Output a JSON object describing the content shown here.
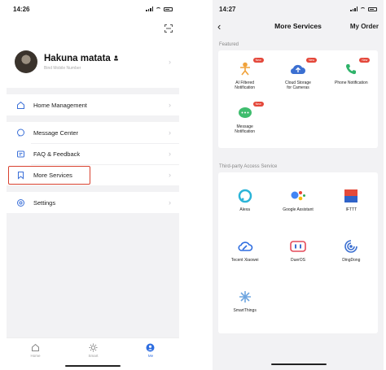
{
  "left": {
    "status_time": "14:26",
    "profile": {
      "name": "Hakuna matata",
      "subtitle": "Bind Mobile Number"
    },
    "menu_group_1": [
      {
        "label": "Home Management",
        "icon": "house-icon"
      }
    ],
    "menu_group_2": [
      {
        "label": "Message Center",
        "icon": "chat-icon"
      },
      {
        "label": "FAQ & Feedback",
        "icon": "feedback-icon"
      },
      {
        "label": "More Services",
        "icon": "bookmark-icon",
        "highlighted": true
      }
    ],
    "menu_group_3": [
      {
        "label": "Settings",
        "icon": "gear-icon"
      }
    ],
    "tabs": [
      {
        "label": "Home",
        "icon": "house-icon",
        "active": false
      },
      {
        "label": "Smart",
        "icon": "sun-icon",
        "active": false
      },
      {
        "label": "Me",
        "icon": "person-icon",
        "active": true
      }
    ],
    "highlight_color": "#d8412f"
  },
  "right": {
    "status_time": "14:27",
    "nav": {
      "title": "More Services",
      "action": "My Order"
    },
    "featured_title": "Featured",
    "featured": [
      {
        "label": "AI Filtered\nNotification",
        "icon": "ai-person-icon",
        "badge": "New"
      },
      {
        "label": "Cloud Storage\nfor Cameras",
        "icon": "cloud-upload-icon",
        "badge": "New"
      },
      {
        "label": "Phone Notification",
        "icon": "phone-icon",
        "badge": "New"
      },
      {
        "label": "Message\nNotification",
        "icon": "message-bubble-icon",
        "badge": "New"
      }
    ],
    "third_party_title": "Third-party Access Service",
    "third_party": [
      {
        "label": "Alexa",
        "icon": "alexa-icon"
      },
      {
        "label": "Google Assistant",
        "icon": "google-assistant-icon"
      },
      {
        "label": "IFTTT",
        "icon": "ifttt-icon"
      },
      {
        "label": "Tecent Xiaowei",
        "icon": "xiaowei-icon"
      },
      {
        "label": "DuerOS",
        "icon": "dueros-icon"
      },
      {
        "label": "DingDong",
        "icon": "dingdong-icon"
      },
      {
        "label": "SmartThings",
        "icon": "smartthings-icon"
      }
    ],
    "accent_colors": {
      "alexa": "#2bb4d8",
      "google_blue": "#4285f4",
      "google_red": "#ea4335",
      "google_yellow": "#fbbc05",
      "google_green": "#34a853",
      "ifttt": "#e44a3a",
      "badge": "#e4473a"
    }
  }
}
